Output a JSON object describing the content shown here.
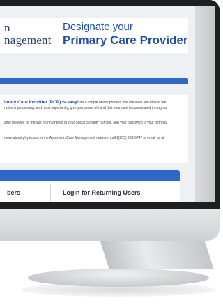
{
  "brand": {
    "line1": "n",
    "line2": "nagement"
  },
  "header": {
    "title": "Designate your",
    "subtitle": "Primary Care Provider"
  },
  "intro": {
    "bold": "imary Care Provider (PCP) is easy!",
    "rest": " It's a simple online process that will save you time at the",
    "line2": "r claims processing, and most importantly, give you peace of mind that your care is coordinated through a"
  },
  "login_info": "ame followed by the last four numbers of your Social Security number, and your password is your birthday",
  "more_info": "more about physicians in the Ascension Care Management network, call 1(855) 288-6747 or email us at",
  "tabs": {
    "left": "bers",
    "right": "Login for Returning Users"
  },
  "colors": {
    "accent": "#2f66c7",
    "brand_navy": "#1f3b6e",
    "title_blue": "#1f4fa3"
  }
}
